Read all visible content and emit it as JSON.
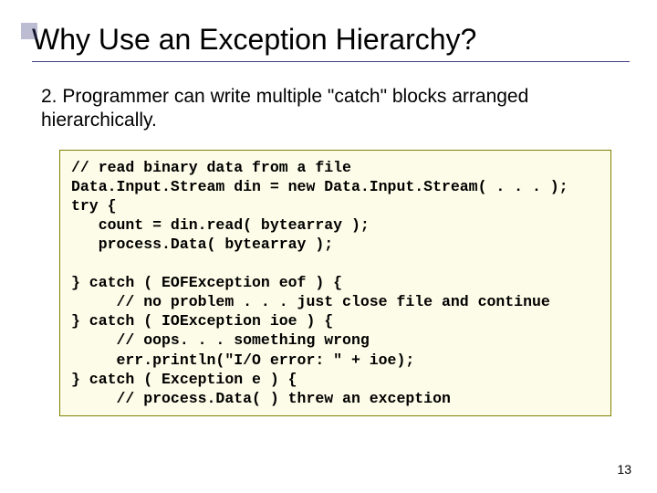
{
  "slide": {
    "title": "Why Use an Exception Hierarchy?",
    "body": "2. Programmer can write multiple \"catch\" blocks arranged hierarchically.",
    "code": "// read binary data from a file\nData.Input.Stream din = new Data.Input.Stream( . . . );\ntry {\n   count = din.read( bytearray );\n   process.Data( bytearray );\n\n} catch ( EOFException eof ) {\n     // no problem . . . just close file and continue\n} catch ( IOException ioe ) {\n     // oops. . . something wrong\n     err.println(\"I/O error: \" + ioe);\n} catch ( Exception e ) {\n     // process.Data( ) threw an exception",
    "page_number": "13"
  }
}
